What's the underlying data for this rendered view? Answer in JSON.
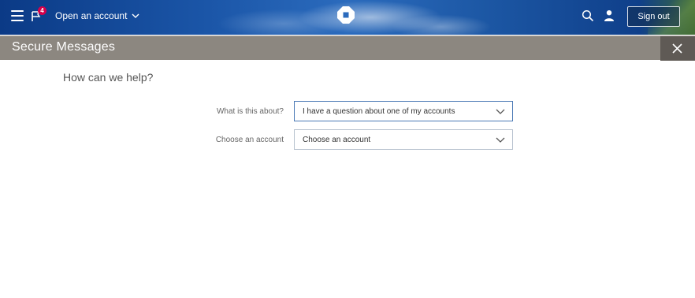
{
  "header": {
    "menu_icon": "hamburger-icon",
    "flag_icon": "flag-icon",
    "notification_count": "4",
    "open_account_label": "Open an account",
    "logo_icon": "chase-octagon-logo",
    "search_icon": "search-icon",
    "profile_icon": "person-icon",
    "signout_label": "Sign out"
  },
  "panel": {
    "title": "Secure Messages",
    "close_icon": "close-icon"
  },
  "form": {
    "heading": "How can we help?",
    "topic_label": "What is this about?",
    "topic_value": "I have a question about one of my accounts",
    "account_label": "Choose an account",
    "account_value": "Choose an account"
  },
  "colors": {
    "header_blue": "#1b56a8",
    "panel_gray": "#8c8780",
    "close_gray": "#5f5a55",
    "badge_red": "#d6004b",
    "focus_border": "#4a79b5"
  }
}
